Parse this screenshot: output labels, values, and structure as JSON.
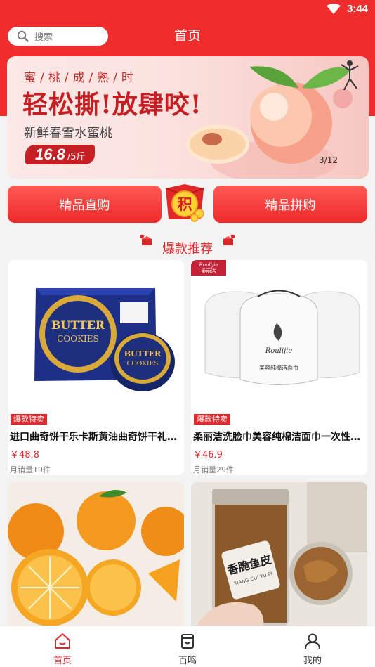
{
  "status_bar": {
    "time": "3:44"
  },
  "header": {
    "search_placeholder": "搜索",
    "title": "首页"
  },
  "banner": {
    "subtitle": "蜜/桃/成/熟/时",
    "headline": "轻松撕!放肆咬!",
    "description": "新鲜春雪水蜜桃",
    "price": "16.8",
    "price_unit": "/5斤",
    "pager": "3/12"
  },
  "actions": {
    "left_label": "精品直购",
    "right_label": "精品拼购",
    "badge": "积"
  },
  "section": {
    "title": "爆款推荐"
  },
  "products": [
    {
      "tag": "爆款特卖",
      "name": "进口曲奇饼干乐卡斯黄油曲奇饼干礼盒装",
      "price": "￥48.8",
      "sales": "月销量19件",
      "art": "butter-cookies-box"
    },
    {
      "tag": "爆款特卖",
      "name": "柔丽洁洗脸巾美容纯棉洁面巾一次性洗脸巾",
      "price": "￥46.9",
      "sales": "月销量29件",
      "art": "face-towel-rolls",
      "brand_en": "Roulijie",
      "brand_cn": "柔丽洁",
      "pack_text": "美容纯棉洁面巾"
    },
    {
      "art": "oranges"
    },
    {
      "art": "crispy-fish-skin-jar",
      "jar_label": "香脆鱼皮",
      "jar_sub": "XIANG CUI YU PI"
    }
  ],
  "bottom_nav": [
    {
      "label": "首页",
      "icon": "home-icon",
      "active": true
    },
    {
      "label": "百鸣",
      "icon": "box-icon",
      "active": false
    },
    {
      "label": "我的",
      "icon": "user-icon",
      "active": false
    }
  ],
  "colors": {
    "brand_red": "#ef2d2d",
    "price_red": "#e5262b"
  }
}
